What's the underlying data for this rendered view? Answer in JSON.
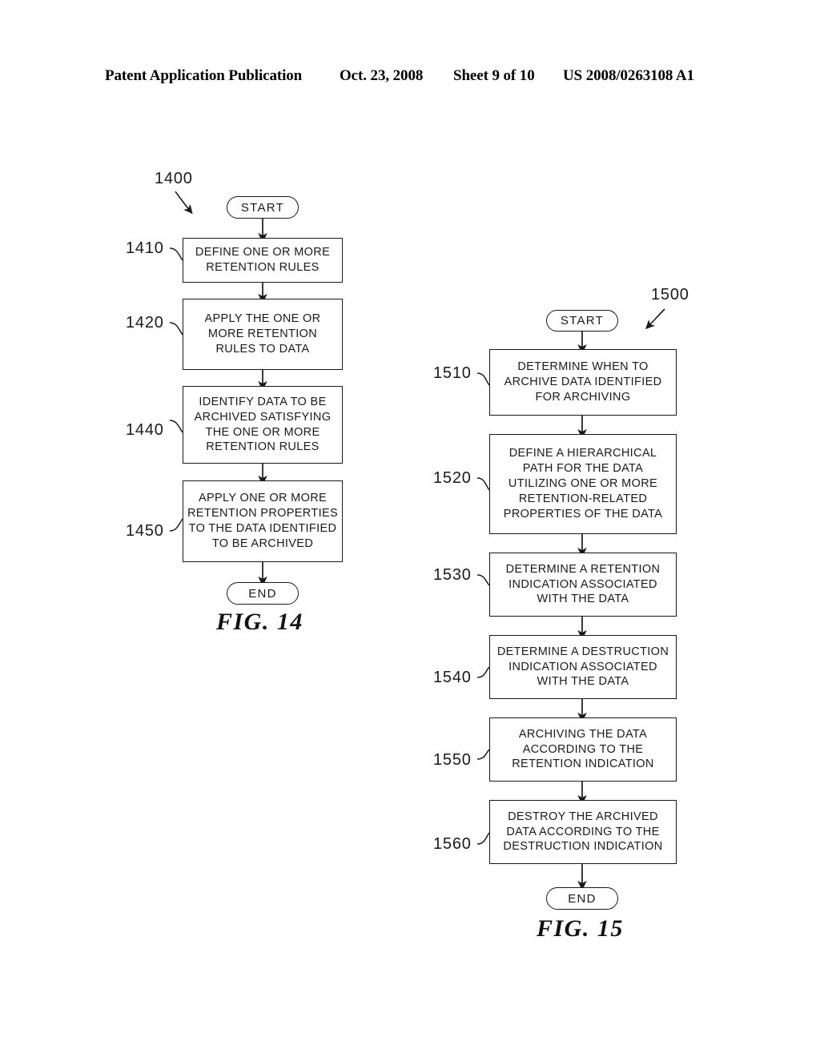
{
  "header": {
    "publication": "Patent Application Publication",
    "date": "Oct. 23, 2008",
    "sheet": "Sheet 9 of 10",
    "patent_number": "US 2008/0263108 A1"
  },
  "figures": [
    {
      "id": "fig14",
      "caption": "FIG. 14",
      "figure_ref": "1400",
      "start_label": "START",
      "end_label": "END",
      "steps": [
        {
          "ref": "1410",
          "lines": [
            "DEFINE ONE OR MORE",
            "RETENTION RULES"
          ]
        },
        {
          "ref": "1420",
          "lines": [
            "APPLY THE ONE OR",
            "MORE RETENTION",
            "RULES TO DATA"
          ]
        },
        {
          "ref": "1440",
          "lines": [
            "IDENTIFY DATA TO BE",
            "ARCHIVED SATISFYING",
            "THE ONE OR MORE",
            "RETENTION RULES"
          ]
        },
        {
          "ref": "1450",
          "lines": [
            "APPLY ONE OR MORE",
            "RETENTION PROPERTIES",
            "TO THE DATA IDENTIFIED",
            "TO BE ARCHIVED"
          ]
        }
      ]
    },
    {
      "id": "fig15",
      "caption": "FIG. 15",
      "figure_ref": "1500",
      "start_label": "START",
      "end_label": "END",
      "steps": [
        {
          "ref": "1510",
          "lines": [
            "DETERMINE WHEN TO",
            "ARCHIVE DATA IDENTIFIED",
            "FOR ARCHIVING"
          ]
        },
        {
          "ref": "1520",
          "lines": [
            "DEFINE A HIERARCHICAL",
            "PATH FOR THE DATA",
            "UTILIZING ONE OR MORE",
            "RETENTION-RELATED",
            "PROPERTIES OF THE DATA"
          ]
        },
        {
          "ref": "1530",
          "lines": [
            "DETERMINE A RETENTION",
            "INDICATION ASSOCIATED",
            "WITH THE DATA"
          ]
        },
        {
          "ref": "1540",
          "lines": [
            "DETERMINE A DESTRUCTION",
            "INDICATION ASSOCIATED",
            "WITH THE DATA"
          ]
        },
        {
          "ref": "1550",
          "lines": [
            "ARCHIVING THE DATA",
            "ACCORDING TO THE",
            "RETENTION INDICATION"
          ]
        },
        {
          "ref": "1560",
          "lines": [
            "DESTROY THE ARCHIVED",
            "DATA ACCORDING TO THE",
            "DESTRUCTION INDICATION"
          ]
        }
      ]
    }
  ],
  "colors": {
    "ink": "#1a1a1a",
    "paper": "#ffffff"
  }
}
